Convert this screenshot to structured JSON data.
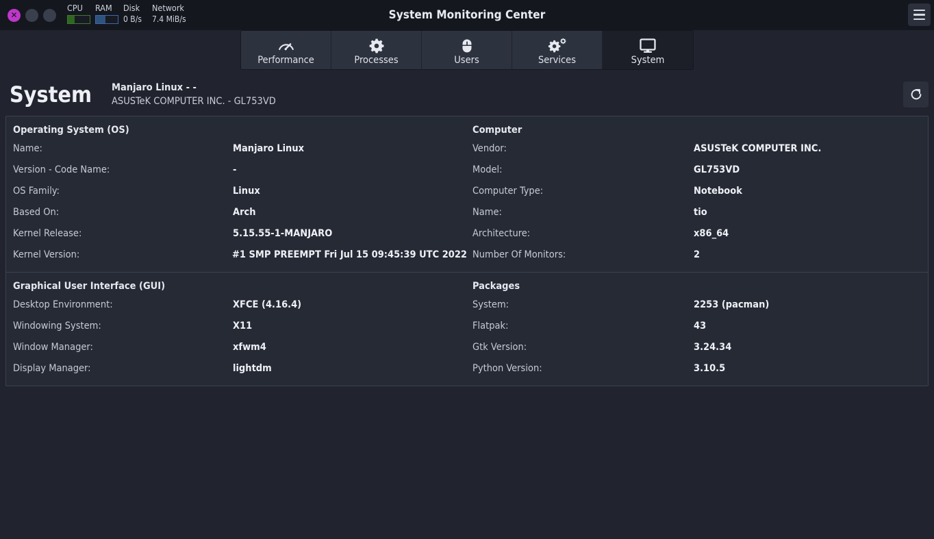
{
  "window": {
    "title": "System Monitoring Center",
    "close_glyph": "✕",
    "menu_icon": "hamburger-icon"
  },
  "monitors": [
    {
      "label": "CPU",
      "type": "bar",
      "fill_percent": 30,
      "color": "#2f6620",
      "border": "#3f7a2c"
    },
    {
      "label": "RAM",
      "type": "bar",
      "fill_percent": 45,
      "color": "#2f537f",
      "border": "#3c6aa8"
    },
    {
      "label": "Disk",
      "type": "text",
      "value": "0 B/s"
    },
    {
      "label": "Network",
      "type": "text",
      "value": "7.4 MiB/s"
    }
  ],
  "tabs": [
    {
      "label": "Performance",
      "icon": "speedometer-icon",
      "active": false
    },
    {
      "label": "Processes",
      "icon": "gear-icon",
      "active": false
    },
    {
      "label": "Users",
      "icon": "mouse-icon",
      "active": false
    },
    {
      "label": "Services",
      "icon": "two-gears-icon",
      "active": false
    },
    {
      "label": "System",
      "icon": "monitor-icon",
      "active": true
    }
  ],
  "header": {
    "title": "System",
    "subtitle_line1": "Manjaro Linux - -",
    "subtitle_line2": "ASUSTeK COMPUTER INC. - GL753VD",
    "refresh_icon": "refresh-icon"
  },
  "groups": [
    {
      "left_heading": "Operating System (OS)",
      "right_heading": "Computer",
      "rows": [
        {
          "lk": "Name:",
          "lv": "Manjaro Linux",
          "rk": "Vendor:",
          "rv": "ASUSTeK COMPUTER INC."
        },
        {
          "lk": "Version - Code Name:",
          "lv": "-",
          "rk": "Model:",
          "rv": "GL753VD"
        },
        {
          "lk": "OS Family:",
          "lv": "Linux",
          "rk": "Computer Type:",
          "rv": "Notebook"
        },
        {
          "lk": "Based On:",
          "lv": "Arch",
          "rk": "Name:",
          "rv": "tio"
        },
        {
          "lk": "Kernel Release:",
          "lv": "5.15.55-1-MANJARO",
          "rk": "Architecture:",
          "rv": "x86_64"
        },
        {
          "lk": "Kernel Version:",
          "lv": "#1 SMP PREEMPT Fri Jul 15 09:45:39 UTC 2022",
          "rk": "Number Of Monitors:",
          "rv": "2"
        }
      ]
    },
    {
      "left_heading": "Graphical User Interface (GUI)",
      "right_heading": "Packages",
      "rows": [
        {
          "lk": "Desktop Environment:",
          "lv": "XFCE (4.16.4)",
          "rk": "System:",
          "rv": "2253 (pacman)"
        },
        {
          "lk": "Windowing System:",
          "lv": "X11",
          "rk": "Flatpak:",
          "rv": "43"
        },
        {
          "lk": "Window Manager:",
          "lv": "xfwm4",
          "rk": "Gtk Version:",
          "rv": "3.24.34"
        },
        {
          "lk": "Display Manager:",
          "lv": "lightdm",
          "rk": "Python Version:",
          "rv": "3.10.5"
        }
      ]
    }
  ],
  "colors": {
    "window_bg": "#21242e",
    "titlebar_bg": "#15171f",
    "panel_bg": "#262a35",
    "panel_border": "#3b4150",
    "tab_bg": "#2d323f",
    "tab_active_bg": "#1c1f28",
    "close_button": "#bd38c9",
    "cpu_green": "#2f6620",
    "ram_blue": "#2f537f"
  }
}
